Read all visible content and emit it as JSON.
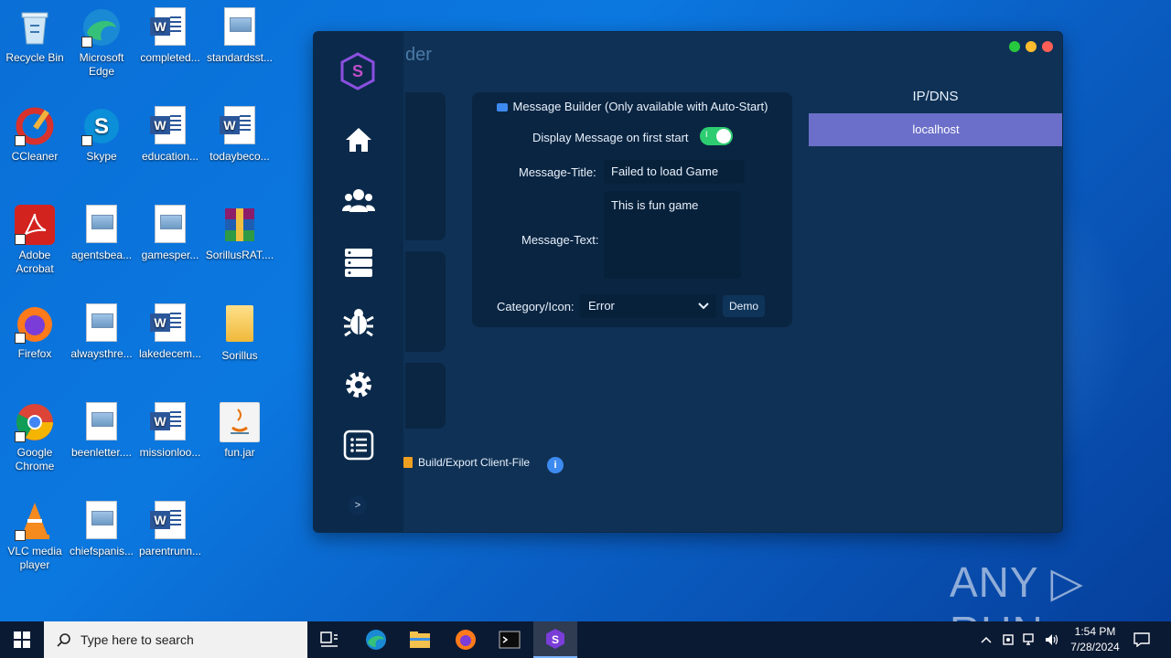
{
  "desktop": {
    "icons": [
      {
        "label": "Recycle Bin"
      },
      {
        "label": "Microsoft Edge"
      },
      {
        "label": "completed..."
      },
      {
        "label": "standardsst..."
      },
      {
        "label": "CCleaner"
      },
      {
        "label": "Skype"
      },
      {
        "label": "education..."
      },
      {
        "label": "todaybeco..."
      },
      {
        "label": "Adobe Acrobat"
      },
      {
        "label": "agentsbea..."
      },
      {
        "label": "gamesper..."
      },
      {
        "label": "SorillusRAT...."
      },
      {
        "label": "Firefox"
      },
      {
        "label": "alwaysthre..."
      },
      {
        "label": "lakedecem..."
      },
      {
        "label": "Sorillus"
      },
      {
        "label": "Google Chrome"
      },
      {
        "label": "beenletter...."
      },
      {
        "label": "missionloo..."
      },
      {
        "label": "fun.jar"
      },
      {
        "label": "VLC media player"
      },
      {
        "label": "chiefspanis..."
      },
      {
        "label": "parentrunn..."
      }
    ]
  },
  "app": {
    "title_fragment": "der",
    "nav": [
      "home",
      "clients",
      "servers",
      "bug",
      "settings",
      "list"
    ],
    "collapse_label": ">",
    "message_builder": {
      "header": "Message Builder (Only available with Auto-Start)",
      "display_label": "Display Message on first start",
      "toggle_on": true,
      "toggle_glyph": "I",
      "title_label": "Message-Title:",
      "title_value": "Failed to load Game",
      "text_label": "Message-Text:",
      "text_value": "This is fun game",
      "category_label": "Category/Icon:",
      "category_value": "Error",
      "demo_label": "Demo"
    },
    "ipdns": {
      "header": "IP/DNS",
      "rows": [
        "localhost"
      ]
    },
    "build_label": "Build/Export Client-File",
    "info_glyph": "i"
  },
  "watermark": "ANY ▷ RUN",
  "taskbar": {
    "search_placeholder": "Type here to search",
    "time": "1:54 PM",
    "date": "7/28/2024"
  }
}
